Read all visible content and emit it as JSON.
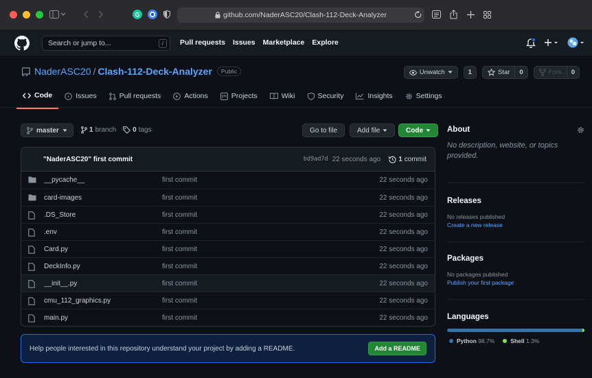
{
  "browser": {
    "url": "github.com/NaderASC20/Clash-112-Deck-Analyzer"
  },
  "header": {
    "search_placeholder": "Search or jump to...",
    "slash": "/",
    "nav": [
      "Pull requests",
      "Issues",
      "Marketplace",
      "Explore"
    ]
  },
  "repo": {
    "owner": "NaderASC20",
    "separator": "/",
    "name": "Clash-112-Deck-Analyzer",
    "visibility": "Public",
    "unwatch_label": "Unwatch",
    "watch_count": "1",
    "star_label": "Star",
    "star_count": "0",
    "fork_label": "Fork",
    "fork_count": "0"
  },
  "tabs": [
    {
      "label": "Code",
      "icon": "code-icon"
    },
    {
      "label": "Issues",
      "icon": "issue-icon"
    },
    {
      "label": "Pull requests",
      "icon": "pull-request-icon"
    },
    {
      "label": "Actions",
      "icon": "play-icon"
    },
    {
      "label": "Projects",
      "icon": "project-icon"
    },
    {
      "label": "Wiki",
      "icon": "book-icon"
    },
    {
      "label": "Security",
      "icon": "shield-icon"
    },
    {
      "label": "Insights",
      "icon": "graph-icon"
    },
    {
      "label": "Settings",
      "icon": "gear-icon"
    }
  ],
  "filenav": {
    "branch": "master",
    "branch_count": "1",
    "branch_word": "branch",
    "tag_count": "0",
    "tag_word": "tags",
    "go_to_file": "Go to file",
    "add_file": "Add file",
    "code": "Code"
  },
  "commit": {
    "message": "\"NaderASC20\" first commit",
    "sha": "bd9ad7d",
    "age": "22 seconds ago",
    "count": "1",
    "count_word": "commit"
  },
  "files": [
    {
      "type": "dir",
      "name": "__pycache__",
      "message": "first commit",
      "age": "22 seconds ago"
    },
    {
      "type": "dir",
      "name": "card-images",
      "message": "first commit",
      "age": "22 seconds ago"
    },
    {
      "type": "file",
      "name": ".DS_Store",
      "message": "first commit",
      "age": "22 seconds ago"
    },
    {
      "type": "file",
      "name": ".env",
      "message": "first commit",
      "age": "22 seconds ago"
    },
    {
      "type": "file",
      "name": "Card.py",
      "message": "first commit",
      "age": "22 seconds ago"
    },
    {
      "type": "file",
      "name": "DeckInfo.py",
      "message": "first commit",
      "age": "22 seconds ago"
    },
    {
      "type": "file",
      "name": "__init__.py",
      "message": "first commit",
      "age": "22 seconds ago"
    },
    {
      "type": "file",
      "name": "cmu_112_graphics.py",
      "message": "first commit",
      "age": "22 seconds ago"
    },
    {
      "type": "file",
      "name": "main.py",
      "message": "first commit",
      "age": "22 seconds ago"
    }
  ],
  "readme": {
    "text": "Help people interested in this repository understand your project by adding a README.",
    "button": "Add a README"
  },
  "sidebar": {
    "about_title": "About",
    "about_desc": "No description, website, or topics provided.",
    "releases_title": "Releases",
    "releases_text": "No releases published",
    "releases_link": "Create a new release",
    "packages_title": "Packages",
    "packages_text": "No packages published",
    "packages_link": "Publish your first package",
    "languages_title": "Languages",
    "languages": [
      {
        "name": "Python",
        "percent": "98.7%",
        "value": 98.7,
        "color": "#3572A5"
      },
      {
        "name": "Shell",
        "percent": "1.3%",
        "value": 1.3,
        "color": "#89e051"
      }
    ]
  },
  "colors": {
    "accent": "#58a6ff",
    "green": "#238636",
    "tab_underline": "#f78166"
  }
}
